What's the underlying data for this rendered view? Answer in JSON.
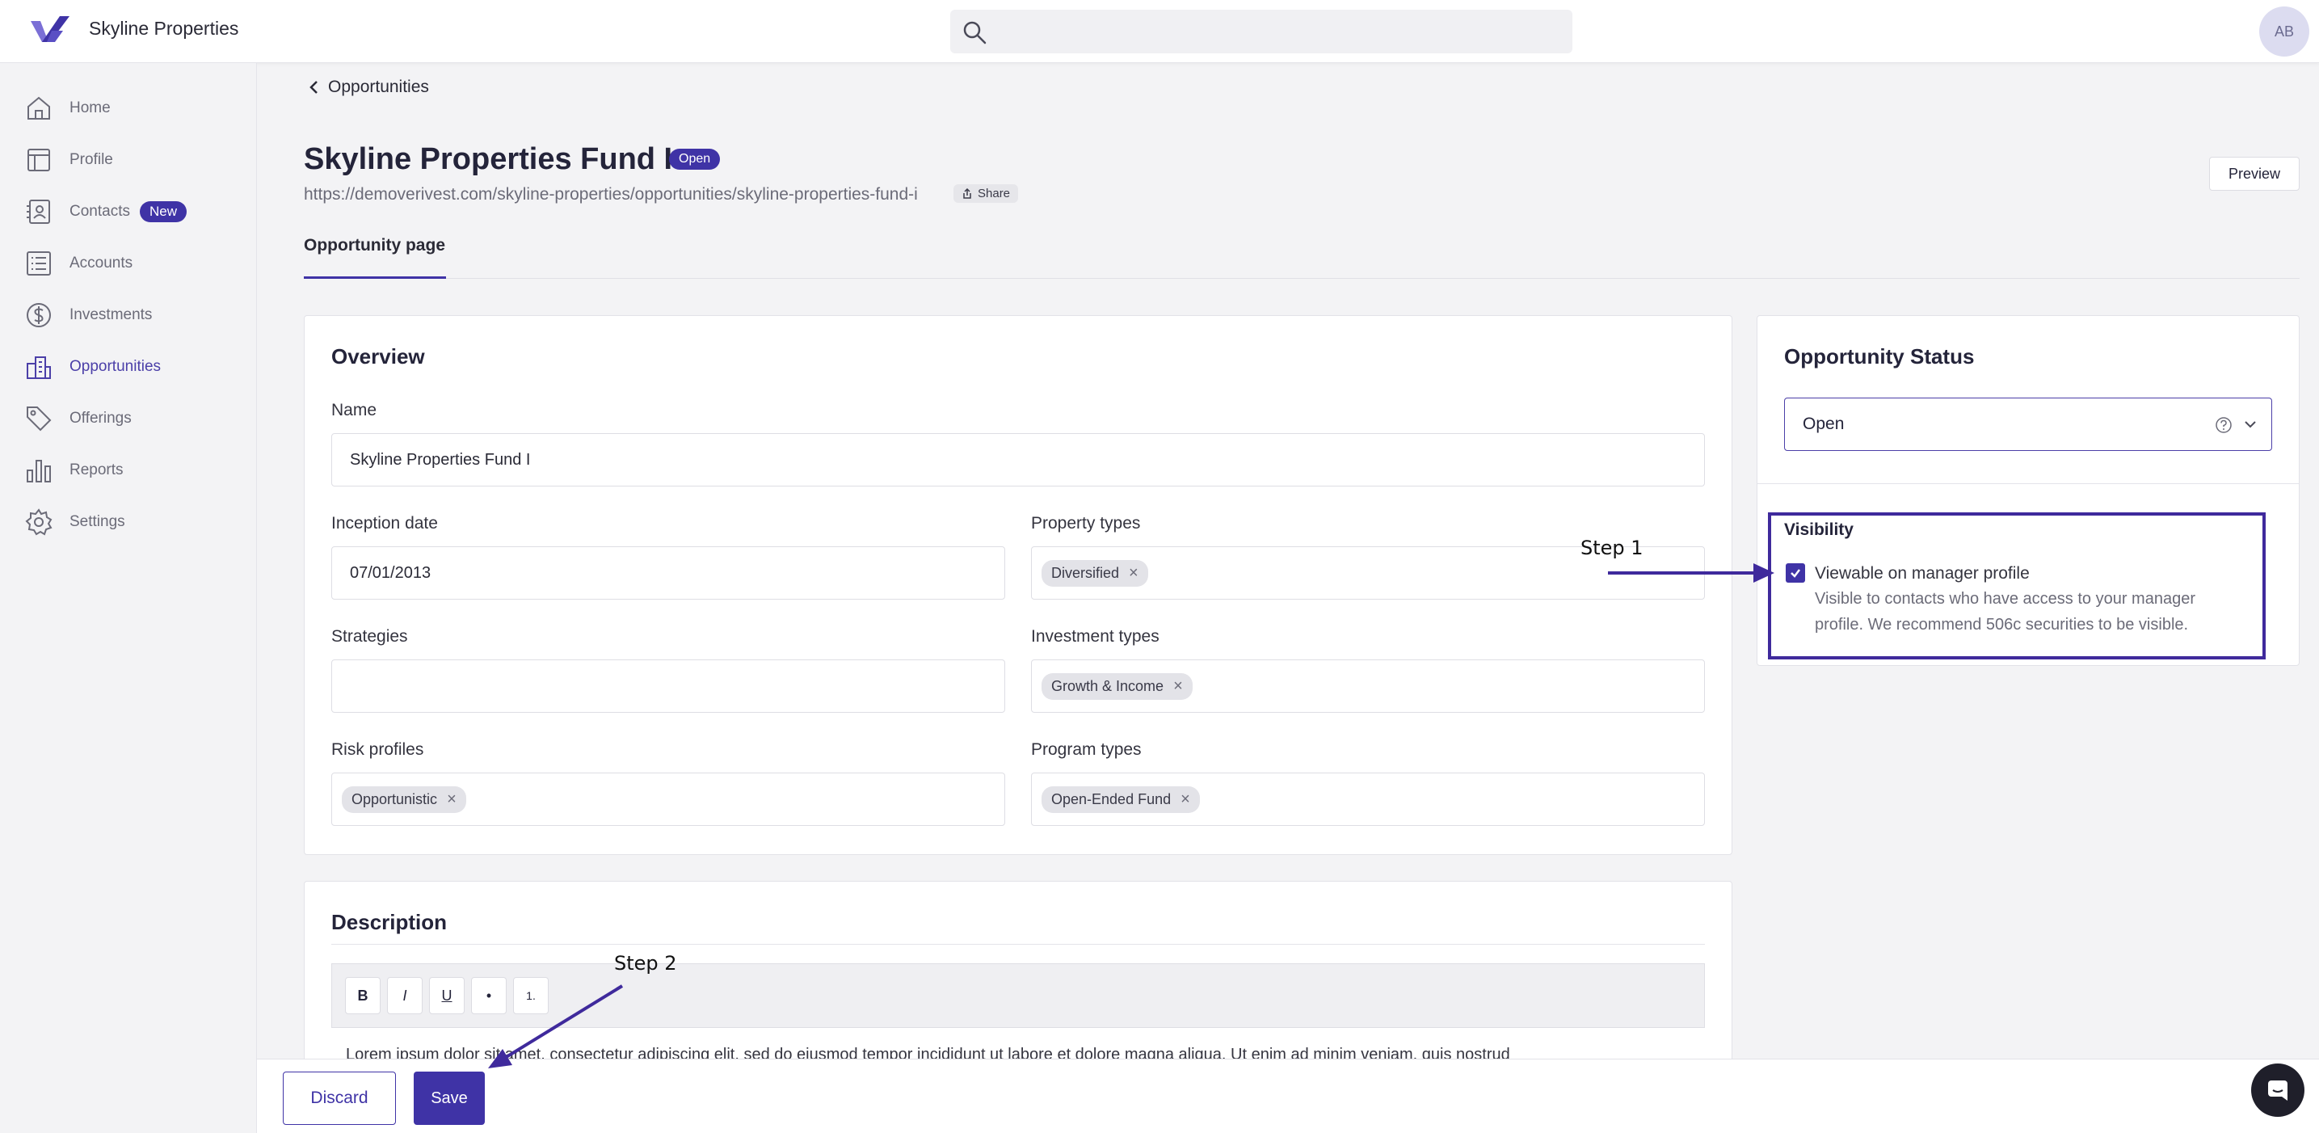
{
  "app": {
    "brand": "Skyline Properties",
    "avatar_initials": "AB"
  },
  "colors": {
    "accent": "#3f33a6",
    "annotation": "#3f2a9c"
  },
  "sidebar": {
    "items": [
      {
        "label": "Home",
        "icon": "home-icon"
      },
      {
        "label": "Profile",
        "icon": "profile-icon"
      },
      {
        "label": "Contacts",
        "icon": "contacts-icon",
        "badge": "New"
      },
      {
        "label": "Accounts",
        "icon": "accounts-icon"
      },
      {
        "label": "Investments",
        "icon": "dollar-icon"
      },
      {
        "label": "Opportunities",
        "icon": "building-icon",
        "active": true
      },
      {
        "label": "Offerings",
        "icon": "tag-icon"
      },
      {
        "label": "Reports",
        "icon": "bar-chart-icon"
      },
      {
        "label": "Settings",
        "icon": "gear-icon"
      }
    ]
  },
  "header": {
    "back_label": "Opportunities",
    "title": "Skyline Properties Fund I",
    "status": "Open",
    "url": "https://demoverivest.com/skyline-properties/opportunities/skyline-properties-fund-i",
    "share_label": "Share",
    "preview_label": "Preview",
    "tab": "Opportunity page"
  },
  "overview": {
    "title": "Overview",
    "name_label": "Name",
    "name_value": "Skyline Properties Fund I",
    "inception_label": "Inception date",
    "inception_value": "07/01/2013",
    "property_types_label": "Property types",
    "property_types": [
      "Diversified"
    ],
    "strategies_label": "Strategies",
    "strategies_value": "",
    "investment_types_label": "Investment types",
    "investment_types": [
      "Growth & Income"
    ],
    "risk_profiles_label": "Risk profiles",
    "risk_profiles": [
      "Opportunistic"
    ],
    "program_types_label": "Program types",
    "program_types": [
      "Open-Ended Fund"
    ]
  },
  "status_card": {
    "title": "Opportunity Status",
    "selected": "Open",
    "visibility_title": "Visibility",
    "checkbox_label": "Viewable on manager profile",
    "checkbox_checked": true,
    "help_line1": "Visible to contacts who have access to your manager",
    "help_line2": "profile. We recommend 506c securities to be visible."
  },
  "description": {
    "title": "Description",
    "toolbar": [
      "B",
      "I",
      "U",
      "•",
      "1."
    ],
    "text": "Lorem ipsum dolor sit amet, consectetur adipiscing elit, sed do eiusmod tempor incididunt ut labore et dolore magna aliqua. Ut enim ad minim veniam, quis nostrud"
  },
  "actions": {
    "discard_label": "Discard",
    "save_label": "Save"
  },
  "annotations": {
    "step1": "Step 1",
    "step2": "Step 2"
  }
}
